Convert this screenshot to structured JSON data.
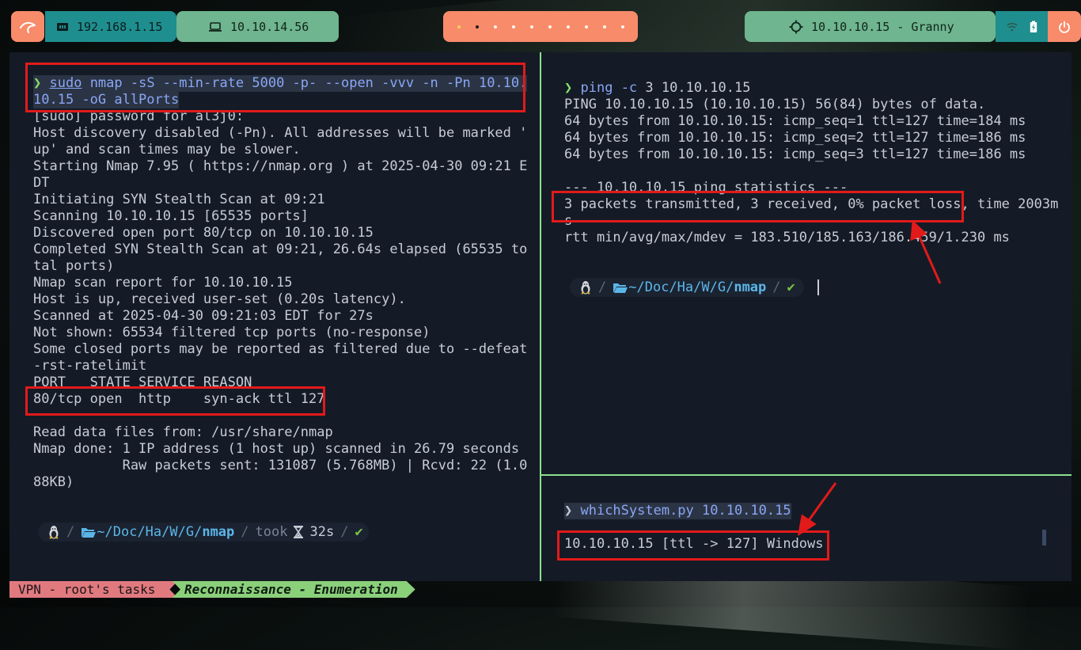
{
  "topbar": {
    "host_ip": "192.168.1.15",
    "vpn_ip": "10.10.14.56",
    "target": "10.10.10.15 - Granny",
    "workspaces": [
      "1",
      "2",
      "3",
      "4",
      "5",
      "6",
      "7",
      "8",
      "9",
      "10"
    ],
    "active_workspace": 2,
    "icons": [
      "kali-dragon-icon",
      "ethernet-icon",
      "laptop-icon",
      "crosshair-icon",
      "wifi-icon",
      "battery-icon",
      "power-icon"
    ]
  },
  "left_pane": {
    "prompt_symbol": "❯",
    "command_sudo": "sudo",
    "command_rest": " nmap -sS --min-rate 5000 -p- --open -vvv -n -Pn 10.10.",
    "command_cont": "10.15 -oG allPorts",
    "output": [
      "[sudo] password for al3j0:",
      "Host discovery disabled (-Pn). All addresses will be marked '",
      "up' and scan times may be slower.",
      "Starting Nmap 7.95 ( https://nmap.org ) at 2025-04-30 09:21 E",
      "DT",
      "Initiating SYN Stealth Scan at 09:21",
      "Scanning 10.10.10.15 [65535 ports]",
      "Discovered open port 80/tcp on 10.10.10.15",
      "Completed SYN Stealth Scan at 09:21, 26.64s elapsed (65535 to",
      "tal ports)",
      "Nmap scan report for 10.10.10.15",
      "Host is up, received user-set (0.20s latency).",
      "Scanned at 2025-04-30 09:21:03 EDT for 27s",
      "Not shown: 65534 filtered tcp ports (no-response)",
      "Some closed ports may be reported as filtered due to --defeat",
      "-rst-ratelimit",
      "PORT   STATE SERVICE REASON",
      "80/tcp open  http    syn-ack ttl 127",
      "",
      "Read data files from: /usr/share/nmap",
      "Nmap done: 1 IP address (1 host up) scanned in 26.79 seconds",
      "           Raw packets sent: 131087 (5.768MB) | Rcvd: 22 (1.0",
      "88KB)"
    ],
    "prompt_path_prefix": "~",
    "prompt_path": "/Doc/Ha/W/G/",
    "prompt_dir": "nmap",
    "took_label": "took",
    "took_value": "32s"
  },
  "right_top_pane": {
    "prompt_symbol": "❯",
    "command_name": "ping",
    "command_flag": " -c",
    "command_args": " 3 10.10.10.15",
    "output": [
      "PING 10.10.10.15 (10.10.10.15) 56(84) bytes of data.",
      "64 bytes from 10.10.10.15: icmp_seq=1 ttl=127 time=184 ms",
      "64 bytes from 10.10.10.15: icmp_seq=2 ttl=127 time=186 ms",
      "64 bytes from 10.10.10.15: icmp_seq=3 ttl=127 time=186 ms",
      "",
      "--- 10.10.10.15 ping statistics ---",
      "3 packets transmitted, 3 received, 0% packet loss, time 2003m",
      "s",
      "rtt min/avg/max/mdev = 183.510/185.163/186.459/1.230 ms"
    ],
    "prompt_path_prefix": "~",
    "prompt_path": "/Doc/Ha/W/G/",
    "prompt_dir": "nmap"
  },
  "right_bottom_pane": {
    "prompt_symbol": "❯",
    "command": " whichSystem.py 10.10.10.15",
    "output": "10.10.10.15 [ttl -> 127] Windows"
  },
  "statusbar": {
    "session": "VPN - root's tasks",
    "window": "Reconnaissance - Enumeration"
  },
  "colors": {
    "highlight_box": "#e21a1a",
    "pane_separator": "#8de08d",
    "terminal_bg": "#141b26",
    "prompt_arrow": "#88e06d",
    "command": "#8aa6f5"
  }
}
